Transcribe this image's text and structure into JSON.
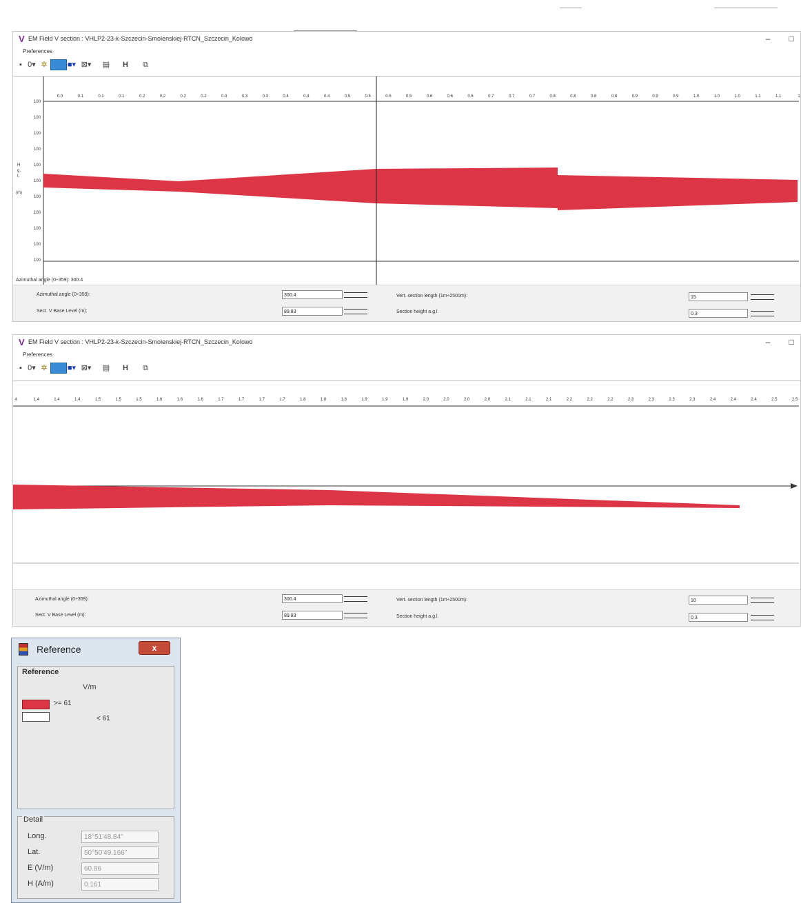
{
  "window1": {
    "title": "EM Field V section : VHLP2-23-k-Szczecin-Smolenskiej-RTCN_Szczecin_Kolowo",
    "menu": "Preferences",
    "y_axis_title": "H\ng.\nt.",
    "y_axis_unit": "(m)",
    "y_ticks": [
      "100",
      "100",
      "100",
      "100",
      "100",
      "100",
      "100",
      "100",
      "100",
      "100",
      "100"
    ],
    "x_ticks": [
      "0.0",
      "0.1",
      "0.1",
      "0.1",
      "0.2",
      "0.2",
      "0.2",
      "0.2",
      "0.3",
      "0.3",
      "0.3",
      "0.4",
      "0.4",
      "0.4",
      "0.5",
      "0.5",
      "0.5",
      "0.5",
      "0.6",
      "0.6",
      "0.6",
      "0.7",
      "0.7",
      "0.7",
      "0.8",
      "0.8",
      "0.8",
      "0.8",
      "0.9",
      "0.9",
      "0.9",
      "1.0",
      "1.0",
      "1.0",
      "1.1",
      "1.1",
      "1"
    ],
    "readout": "Azimuthal angle (0÷359): 300.4",
    "azimuth_label": "Azimuthal angle (0÷359):",
    "azimuth_value": "300.4",
    "base_level_label": "Sect. V Base Level (m):",
    "base_level_value": "89.83",
    "section_length_label": "Vert. section length (1m÷2500m):",
    "section_length_value": "15",
    "section_height_label": "Section height a.g.l.",
    "section_height_value": "0.3"
  },
  "window2": {
    "title": "EM Field V section : VHLP2-23-k-Szczecin-Smolenskiej-RTCN_Szczecin_Kolowo",
    "menu": "Preferences",
    "x_ticks": [
      "4",
      "1.4",
      "1.4",
      "1.4",
      "1.5",
      "1.5",
      "1.5",
      "1.6",
      "1.6",
      "1.6",
      "1.7",
      "1.7",
      "1.7",
      "1.7",
      "1.8",
      "1.8",
      "1.8",
      "1.9",
      "1.9",
      "1.9",
      "2.0",
      "2.0",
      "2.0",
      "2.0",
      "2.1",
      "2.1",
      "2.1",
      "2.2",
      "2.2",
      "2.2",
      "2.3",
      "2.3",
      "2.3",
      "2.3",
      "2.4",
      "2.4",
      "2.4",
      "2.5",
      "2.5"
    ],
    "azimuth_label": "Azimuthal angle (0÷359):",
    "azimuth_value": "300.4",
    "base_level_label": "Sect. V Base Level (m):",
    "base_level_value": "89.83",
    "section_length_label": "Vert. section length (1m÷2500m):",
    "section_length_value": "10",
    "section_height_label": "Section height a.g.l.",
    "section_height_value": "0.3"
  },
  "reference": {
    "title": "Reference",
    "close": "x",
    "legend_title": "Reference",
    "unit": "V/m",
    "ge_label": ">= 61",
    "lt_label": "< 61",
    "detail_title": "Detail",
    "rows": [
      {
        "label": "Long.",
        "value": "18°51'48.84\""
      },
      {
        "label": "Lat.",
        "value": "50°50'49.166\""
      },
      {
        "label": "E (V/m)",
        "value": "60.86"
      },
      {
        "label": "H (A/m)",
        "value": "0.161"
      }
    ]
  },
  "colors": {
    "field": "#dc3545",
    "axis": "#333333",
    "cursor": "#222222"
  }
}
